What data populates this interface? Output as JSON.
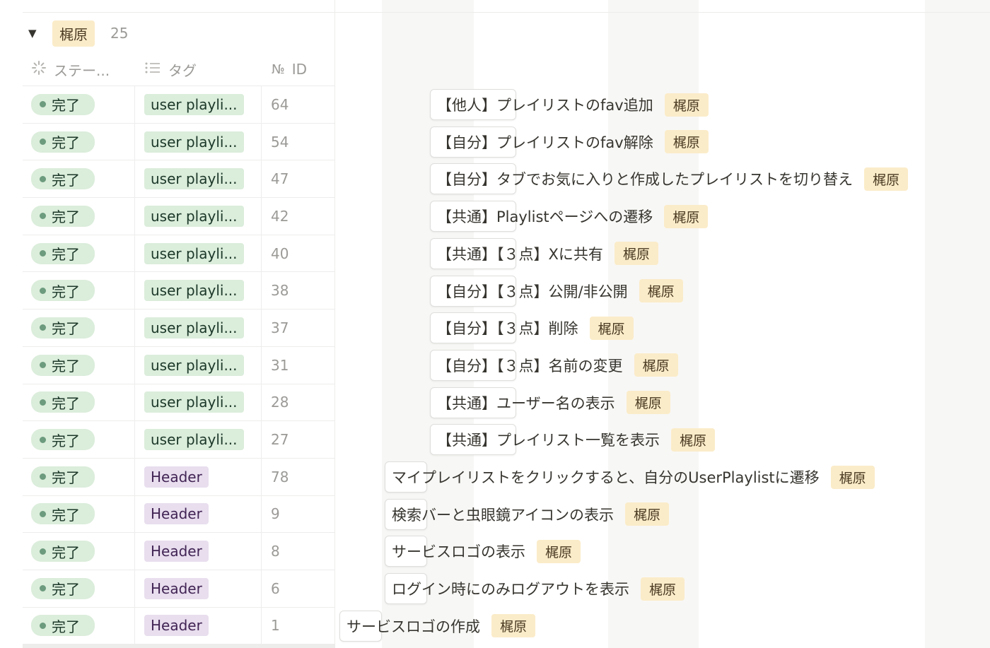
{
  "group": {
    "toggle_icon": "triangle-down-icon",
    "owner": "梶原",
    "count": "25"
  },
  "columns": {
    "status": {
      "label": "ステー...",
      "icon": "status-loader-icon"
    },
    "tag": {
      "label": "タグ",
      "icon": "list-icon"
    },
    "id": {
      "label": "ID",
      "icon": "number-sign-icon"
    }
  },
  "colors": {
    "status_green": "#dbeddb",
    "tag_purple": "#e8deee",
    "owner_yellow": "#fbecc9"
  },
  "rows": [
    {
      "status": "完了",
      "tag": "user playli...",
      "tag_color": "green",
      "id": "64"
    },
    {
      "status": "完了",
      "tag": "user playli...",
      "tag_color": "green",
      "id": "54"
    },
    {
      "status": "完了",
      "tag": "user playli...",
      "tag_color": "green",
      "id": "47"
    },
    {
      "status": "完了",
      "tag": "user playli...",
      "tag_color": "green",
      "id": "42"
    },
    {
      "status": "完了",
      "tag": "user playli...",
      "tag_color": "green",
      "id": "40"
    },
    {
      "status": "完了",
      "tag": "user playli...",
      "tag_color": "green",
      "id": "38"
    },
    {
      "status": "完了",
      "tag": "user playli...",
      "tag_color": "green",
      "id": "37"
    },
    {
      "status": "完了",
      "tag": "user playli...",
      "tag_color": "green",
      "id": "31"
    },
    {
      "status": "完了",
      "tag": "user playli...",
      "tag_color": "green",
      "id": "28"
    },
    {
      "status": "完了",
      "tag": "user playli...",
      "tag_color": "green",
      "id": "27"
    },
    {
      "status": "完了",
      "tag": "Header",
      "tag_color": "purple",
      "id": "78"
    },
    {
      "status": "完了",
      "tag": "Header",
      "tag_color": "purple",
      "id": "9"
    },
    {
      "status": "完了",
      "tag": "Header",
      "tag_color": "purple",
      "id": "8"
    },
    {
      "status": "完了",
      "tag": "Header",
      "tag_color": "purple",
      "id": "6"
    },
    {
      "status": "完了",
      "tag": "Header",
      "tag_color": "purple",
      "id": "1"
    }
  ],
  "timeline": [
    {
      "title": "【他人】プレイリストのfav追加",
      "owner": "梶原"
    },
    {
      "title": "【自分】プレイリストのfav解除",
      "owner": "梶原"
    },
    {
      "title": "【自分】タブでお気に入りと作成したプレイリストを切り替え",
      "owner": "梶原"
    },
    {
      "title": "【共通】Playlistページへの遷移",
      "owner": "梶原"
    },
    {
      "title": "【共通】【３点】Xに共有",
      "owner": "梶原"
    },
    {
      "title": "【自分】【３点】公開/非公開",
      "owner": "梶原"
    },
    {
      "title": "【自分】【３点】削除",
      "owner": "梶原"
    },
    {
      "title": "【自分】【３点】名前の変更",
      "owner": "梶原"
    },
    {
      "title": "【共通】ユーザー名の表示",
      "owner": "梶原"
    },
    {
      "title": "【共通】プレイリスト一覧を表示",
      "owner": "梶原"
    },
    {
      "title": "マイプレイリストをクリックすると、自分のUserPlaylistに遷移",
      "owner": "梶原"
    },
    {
      "title": "検索バーと虫眼鏡アイコンの表示",
      "owner": "梶原"
    },
    {
      "title": "サービスロゴの表示",
      "owner": "梶原"
    },
    {
      "title": "ログイン時にのみログアウトを表示",
      "owner": "梶原"
    },
    {
      "title": "サービスロゴの作成",
      "owner": "梶原"
    }
  ]
}
